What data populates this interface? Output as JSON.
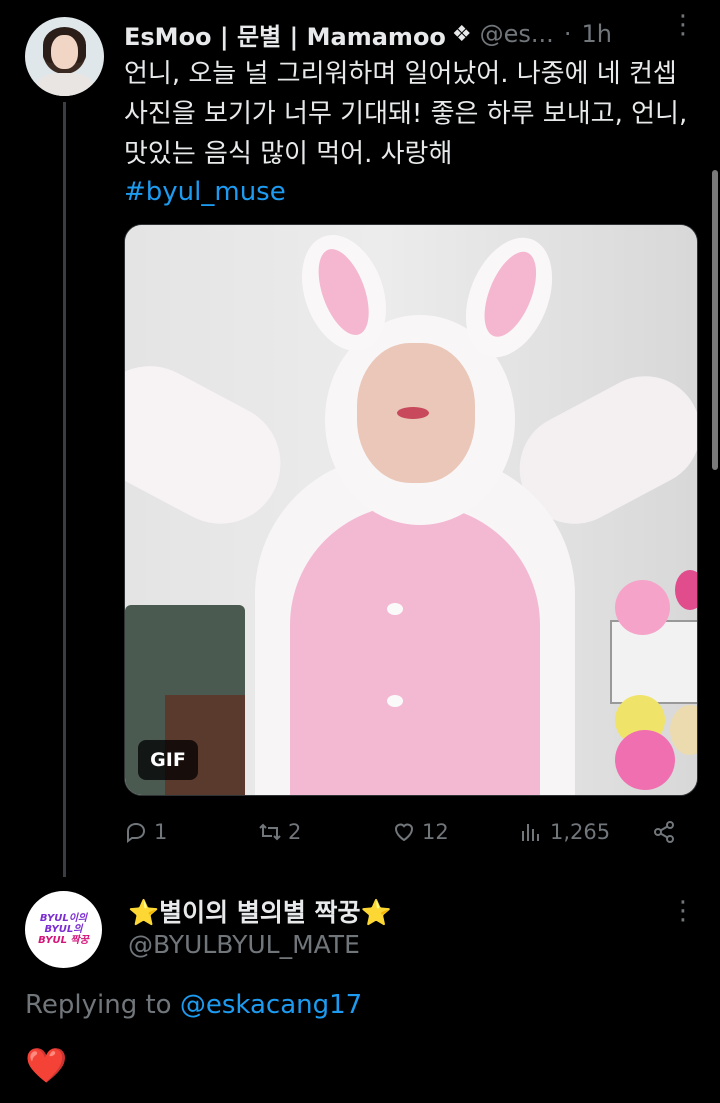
{
  "tweet": {
    "display_name": "EsMoo | 문별 | Mamamoo",
    "badge_glyph": "❖",
    "handle": "@es...",
    "separator": "·",
    "time": "1h",
    "more_glyph": "⋮",
    "text": "언니, 오늘 널 그리워하며 일어났어. 나중에 네 컨셉 사진을 보기가 너무 기대돼! 좋은 하루 보내고, 언니, 맛있는 음식 많이 먹어. 사랑해",
    "hashtag": "#byul_muse",
    "media_badge": "GIF",
    "stats": {
      "replies": "1",
      "retweets": "2",
      "likes": "12",
      "views": "1,265"
    }
  },
  "reply": {
    "avatar_text_line1": "BYUL이의",
    "avatar_text_line2": "BYUL의",
    "avatar_text_line3": "BYUL 짝꿍",
    "star_left": "⭐",
    "display_name": "별이의 별의별 짝꿍",
    "star_right": "⭐",
    "handle": "@BYULBYUL_MATE",
    "more_glyph": "⋮",
    "replying_prefix": "Replying to ",
    "replying_handle": "@eskacang17",
    "body": "❤️"
  },
  "icons": {
    "reply": "reply-icon",
    "retweet": "retweet-icon",
    "like": "heart-icon",
    "views": "views-icon",
    "share": "share-icon"
  },
  "colors": {
    "background": "#000000",
    "text": "#e7e9ea",
    "muted": "#71767b",
    "link": "#1d9bf0"
  }
}
